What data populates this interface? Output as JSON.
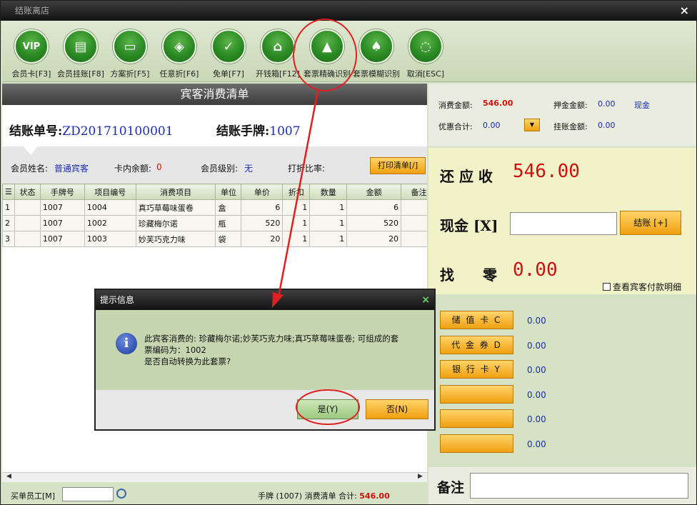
{
  "window": {
    "title": "结账离店",
    "close": "×"
  },
  "toolbar": [
    {
      "label": "会员卡[F3]",
      "icon": "vip-card-icon",
      "glyph": "VIP"
    },
    {
      "label": "会员挂账[F8]",
      "icon": "member-credit-icon",
      "glyph": "▤"
    },
    {
      "label": "方案折[F5]",
      "icon": "plan-discount-icon",
      "glyph": "▭"
    },
    {
      "label": "任意折[F6]",
      "icon": "any-discount-icon",
      "glyph": "◈"
    },
    {
      "label": "免单[F7]",
      "icon": "free-order-icon",
      "glyph": "✓"
    },
    {
      "label": "开钱箱[F12]",
      "icon": "cash-drawer-icon",
      "glyph": "⌂"
    },
    {
      "label": "套票精确识别",
      "icon": "package-exact-icon",
      "glyph": "▲"
    },
    {
      "label": "套票模糊识别",
      "icon": "package-fuzzy-icon",
      "glyph": "♠"
    },
    {
      "label": "取消[ESC]",
      "icon": "cancel-icon",
      "glyph": "◌"
    }
  ],
  "left": {
    "heading": "宾客消费清单",
    "bill_label": "结账单号:",
    "bill_no": "ZD201710100001",
    "tag_label": "结账手牌:",
    "tag_no": "1007",
    "member_name_label": "会员姓名:",
    "member_name": "普通宾客",
    "card_balance_label": "卡内余额:",
    "card_balance": "0",
    "member_level_label": "会员级别:",
    "member_level": "无",
    "discount_label": "打折比率:",
    "print_button": "打印清单[/]"
  },
  "table": {
    "columns": [
      "",
      "状态",
      "手牌号",
      "项目编号",
      "消费项目",
      "单位",
      "单价",
      "折扣",
      "数量",
      "金额",
      "备注说"
    ],
    "rows": [
      [
        "1",
        "",
        "1007",
        "1004",
        "真巧草莓味蛋卷",
        "盒",
        "6",
        "1",
        "1",
        "6",
        ""
      ],
      [
        "2",
        "",
        "1007",
        "1002",
        "珍藏梅尔诺",
        "瓶",
        "520",
        "1",
        "1",
        "520",
        ""
      ],
      [
        "3",
        "",
        "1007",
        "1003",
        "妙芙巧克力味",
        "袋",
        "20",
        "1",
        "1",
        "20",
        ""
      ]
    ]
  },
  "footer": {
    "employee_label": "买单员工[M]",
    "summary": "手牌 (1007) 消费清单 合计:",
    "total": "546.00"
  },
  "right": {
    "consume_label": "消费金额:",
    "consume_value": "546.00",
    "deposit_label": "押金金额:",
    "deposit_value": "0.00",
    "deposit_type": "现金",
    "discount_total_label": "优惠合计:",
    "discount_total_value": "0.00",
    "credit_label": "挂账金额:",
    "credit_value": "0.00",
    "due_label": "还 应 收",
    "due_value": "546.00",
    "cash_label": "现金 [X]",
    "settle_button": "结账 [+]",
    "change_label": "找　　零",
    "change_value": "0.00",
    "view_detail": "查看宾客付款明细"
  },
  "payments": [
    {
      "label": "储 值 卡 C",
      "value": "0.00"
    },
    {
      "label": "代 金 券 D",
      "value": "0.00"
    },
    {
      "label": "银 行 卡 Y",
      "value": "0.00"
    },
    {
      "label": "",
      "value": "0.00"
    },
    {
      "label": "",
      "value": "0.00"
    },
    {
      "label": "",
      "value": "0.00"
    }
  ],
  "remark_label": "备注",
  "dialog": {
    "title": "提示信息",
    "close": "×",
    "line1": "此宾客消费的: 珍藏梅尔诺;妙芙巧克力味;真巧草莓味蛋卷; 可组成的套",
    "line2": "票编码为：1002",
    "line3": "是否自动转换为此套票?",
    "yes": "是(Y)",
    "no": "否(N)"
  },
  "colors": {
    "accent_green": "#2a8a23",
    "button_orange": "#f0a010",
    "value_red": "#d01010",
    "value_blue": "#1b2db0",
    "annotation_red": "#e02020"
  }
}
